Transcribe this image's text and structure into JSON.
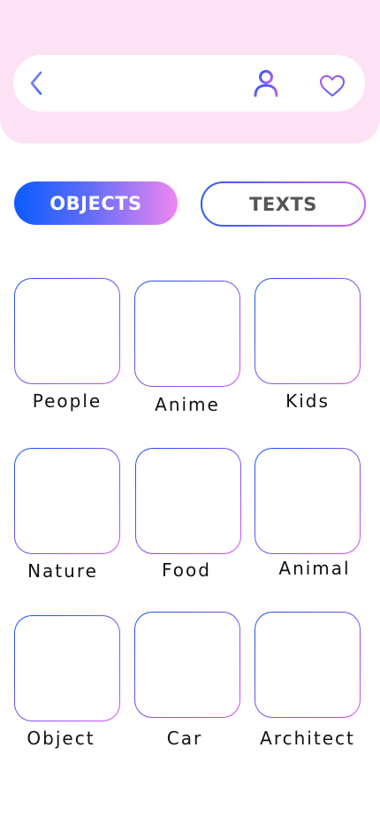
{
  "header": {
    "back_icon": "chevron-left-icon",
    "profile_icon": "user-icon",
    "favorite_icon": "heart-icon"
  },
  "tabs": [
    {
      "label": "OBJECTS",
      "active": true
    },
    {
      "label": "TEXTS",
      "active": false
    }
  ],
  "categories": [
    {
      "label": "People"
    },
    {
      "label": "Anime"
    },
    {
      "label": "Kids"
    },
    {
      "label": "Nature"
    },
    {
      "label": "Food"
    },
    {
      "label": "Animal"
    },
    {
      "label": "Object"
    },
    {
      "label": "Car"
    },
    {
      "label": "Architect"
    }
  ],
  "colors": {
    "header_bg": "#fde2f6",
    "accent_blue": "#0b5cff",
    "accent_pink": "#ef86f1",
    "inactive_text": "#555458"
  }
}
